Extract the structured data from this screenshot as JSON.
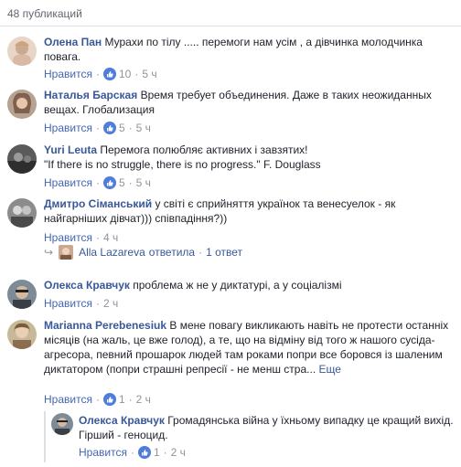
{
  "header": {
    "title": "48 публикаций"
  },
  "comments": [
    {
      "author": "Олена Пан",
      "text": "Мурахи по тілу ..... перемоги нам усім , а дівчинка молодчинка повага.",
      "like_label": "Нравится",
      "likes": "10",
      "time": "5 ч"
    },
    {
      "author": "Наталья Барская",
      "text": "Время требует объединения. Даже в таких неожиданных вещах. Глобализация",
      "like_label": "Нравится",
      "likes": "5",
      "time": "5 ч"
    },
    {
      "author": "Yuri Leuta",
      "text_line1": "Перемога полюбляє активних і завзятих!",
      "text_line2": "\"If there is no struggle, there is no progress.\" F. Douglass",
      "like_label": "Нравится",
      "likes": "5",
      "time": "5 ч"
    },
    {
      "author": "Дмитро Сіманський",
      "text": "у світі є сприйняття українок та венесуелок - як найгарніших дівчат))) співпадіння?))",
      "like_label": "Нравится",
      "time": "4 ч",
      "reply_author": "Alla Lazareva",
      "reply_action": "ответила",
      "reply_count": "1 ответ"
    },
    {
      "author": "Олекса Кравчук",
      "text": "проблема ж не у диктатурі, а у соціалізмі",
      "like_label": "Нравится",
      "time": "2 ч"
    },
    {
      "author": "Marianna Perebenesiuk",
      "text": "В мене повагу викликають навіть не протести останніх місяців (на жаль, це вже голод), а те, що на відміну від того ж нашого сусіда-агресора, певний прошарок людей там роками попри все боровся із шаленим диктатором (попри страшні репресії - не менш стра...",
      "more": "Еще",
      "like_label": "Нравится",
      "likes": "1",
      "time": "2 ч"
    },
    {
      "author": "Олекса Кравчук",
      "text": "Громадянська війна у їхньому випадку це кращий вихід. Гірший - геноцид.",
      "like_label": "Нравится",
      "likes": "1",
      "time": "2 ч"
    }
  ],
  "colors": {
    "link": "#385898",
    "meta": "#90949c",
    "like_blue": "#4f7ddb",
    "divider": "#dddfe2"
  }
}
